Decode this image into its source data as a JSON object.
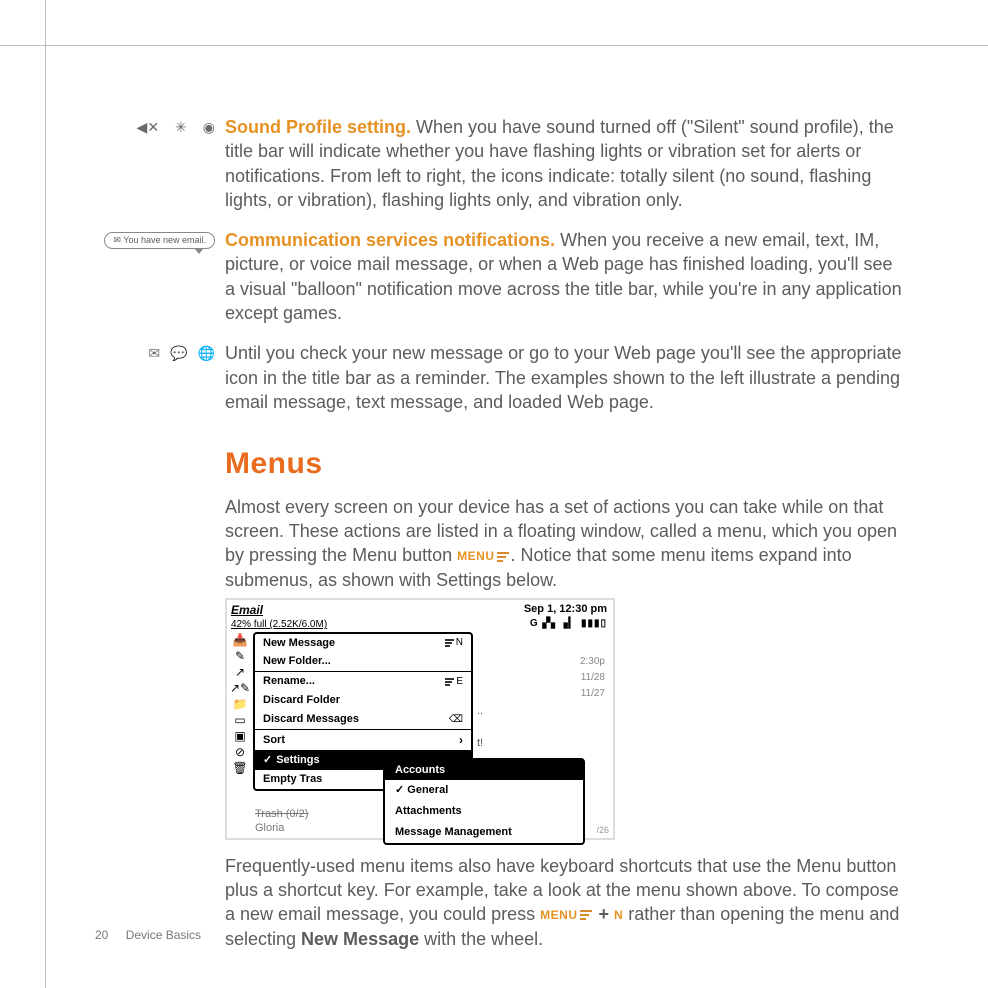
{
  "section1": {
    "lead": "Sound Profile setting.",
    "text": "  When you have sound turned off (\"Silent\" sound profile), the title bar will indicate whether you have flashing lights or vibration set for alerts or notifications. From left to right, the icons indicate: totally silent (no sound, flashing lights, or vibration), flashing lights only, and vibration only."
  },
  "balloon": "You have new email.",
  "section2": {
    "lead": "Communication services notifications.",
    "text": "  When you receive a new email, text, IM, picture, or voice mail message, or when a Web page has finished loading, you'll see a visual \"balloon\" notification move across the title bar, while you're in any application except games."
  },
  "section3": {
    "text": "Until you check your new message or go to your Web page you'll see the appropriate icon in the title bar as a reminder. The examples shown to the left illustrate a pending email message, text message, and loaded Web page."
  },
  "heading": "Menus",
  "intro_a": "Almost every screen on your device has a set of actions you can take while on that screen. These actions are listed in a floating window, called a menu, which you open by pressing the Menu button ",
  "intro_menu_label": "MENU",
  "intro_b": ". Notice that some menu items expand into submenus, as shown with Settings below.",
  "shot": {
    "app": "Email",
    "subtitle": "42% full (2.52K/6.0M)",
    "clock": "Sep 1, 12:30 pm",
    "signal": "G ▞▖▗▎  ▮▮▮▯",
    "menu": {
      "new_message": "New Message",
      "new_message_sc": "N",
      "new_folder": "New Folder...",
      "rename": "Rename...",
      "rename_sc": "E",
      "discard_folder": "Discard Folder",
      "discard_messages": "Discard Messages",
      "discard_messages_sc": "⌫",
      "sort": "Sort",
      "settings": "Settings",
      "empty_trash": "Empty Tras"
    },
    "submenu": {
      "accounts": "Accounts",
      "general": "General",
      "attachments": "Attachments",
      "msg_mgmt": "Message Management"
    },
    "bg": {
      "r1": "2:30p",
      "r2": "11/28",
      "r3": "11/27",
      "frag1": "..",
      "frag2": "t!",
      "bottom_date": "/26"
    },
    "trash1": "Trash (0/2)",
    "trash2": "Gloria"
  },
  "outro_a": "Frequently-used menu items also have keyboard shortcuts that use the Menu button plus a shortcut key. For example, take a look at the menu shown above. To compose a new email message, you could press ",
  "outro_menu_label": "MENU",
  "outro_plus": " + ",
  "outro_key": "N",
  "outro_b": " rather than opening the menu and selecting ",
  "outro_bold": "New Message",
  "outro_c": " with the wheel.",
  "footer": {
    "page": "20",
    "section": "Device Basics"
  }
}
